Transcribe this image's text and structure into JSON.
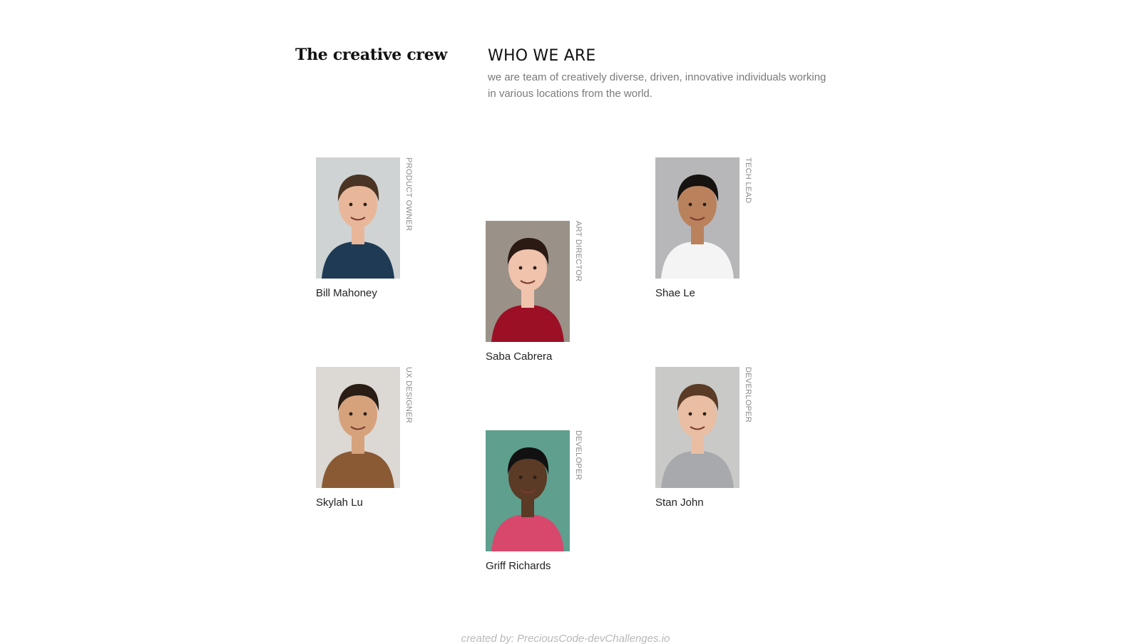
{
  "brand": {
    "title": "The creative crew"
  },
  "intro": {
    "heading": "WHO WE ARE",
    "description": "we are team of creatively diverse, driven, innovative individuals working in various locations from the world."
  },
  "members": [
    {
      "name": "Bill Mahoney",
      "role": "PRODUCT OWNER",
      "bg": "#cfd3d4",
      "skin": "#e8b79a",
      "hair": "#4a3423",
      "shirt": "#1e3a55"
    },
    {
      "name": "Saba Cabrera",
      "role": "ART DIRECTOR",
      "bg": "#9a9288",
      "skin": "#f0c3ad",
      "hair": "#2b1a14",
      "shirt": "#9c1026"
    },
    {
      "name": "Shae Le",
      "role": "TECH LEAD",
      "bg": "#b7b7b9",
      "skin": "#b9825d",
      "hair": "#151210",
      "shirt": "#f4f4f4"
    },
    {
      "name": "Skylah Lu",
      "role": "UX DESIGNER",
      "bg": "#dcd8d4",
      "skin": "#d6a27c",
      "hair": "#2a1d16",
      "shirt": "#8a5a34"
    },
    {
      "name": "Griff Richards",
      "role": "DEVELOPER",
      "bg": "#5f9f8e",
      "skin": "#5b3a26",
      "hair": "#111111",
      "shirt": "#d8476c"
    },
    {
      "name": "Stan John",
      "role": "DEVERLOPER",
      "bg": "#c9c9c7",
      "skin": "#e9bea2",
      "hair": "#5a3b25",
      "shirt": "#a7a9ad"
    }
  ],
  "footer": {
    "text": "created by: PreciousCode-devChallenges.io"
  }
}
